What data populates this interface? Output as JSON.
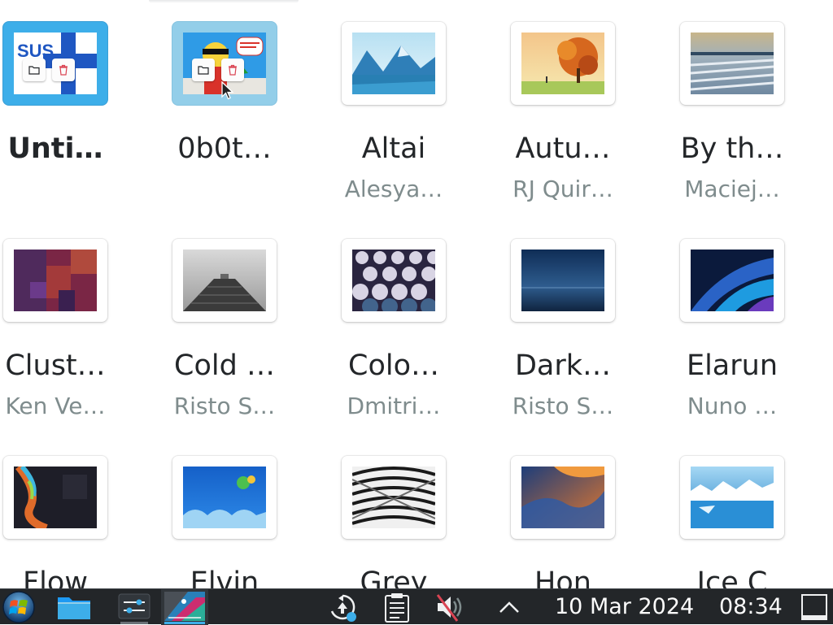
{
  "wallpapers": [
    {
      "name": "Unti…",
      "author": "",
      "state": "selected",
      "thumb": "suse-icon"
    },
    {
      "name": "0b0t…",
      "author": "",
      "state": "hovered",
      "thumb": "cartoon"
    },
    {
      "name": "Altai",
      "author": "Alesya…",
      "thumb": "altai"
    },
    {
      "name": "Autu…",
      "author": "RJ Quir…",
      "thumb": "autumn"
    },
    {
      "name": "By th…",
      "author": "Maciej…",
      "thumb": "by-the-water"
    },
    {
      "name": "Clust…",
      "author": "Ken Ve…",
      "thumb": "cluster"
    },
    {
      "name": "Cold …",
      "author": "Risto S…",
      "thumb": "cold-ripple"
    },
    {
      "name": "Colo…",
      "author": "Dmitri…",
      "thumb": "color-circles"
    },
    {
      "name": "Dark…",
      "author": "Risto S…",
      "thumb": "darkest-hour"
    },
    {
      "name": "Elarun",
      "author": "Nuno …",
      "thumb": "elarun"
    },
    {
      "name": "Flow",
      "author": "",
      "thumb": "flow"
    },
    {
      "name": "Elvin",
      "author": "",
      "thumb": "elvin"
    },
    {
      "name": "Grey",
      "author": "",
      "thumb": "grey"
    },
    {
      "name": "Hon",
      "author": "",
      "thumb": "honeywave"
    },
    {
      "name": "Ice C",
      "author": "",
      "thumb": "ice-cold"
    }
  ],
  "card_actions": {
    "open_folder_icon": "folder-icon",
    "remove_icon": "trash-icon"
  },
  "taskbar": {
    "launcher_icon": "start-orb-icon",
    "tasks": [
      {
        "name": "file-manager",
        "icon": "folder-icon",
        "state": "normal"
      },
      {
        "name": "system-settings",
        "icon": "settings-sliders-icon",
        "state": "open"
      },
      {
        "name": "discover",
        "icon": "app-icon",
        "state": "active"
      }
    ],
    "tray": [
      {
        "name": "updates",
        "icon": "update-icon"
      },
      {
        "name": "clipboard",
        "icon": "clipboard-icon"
      },
      {
        "name": "volume",
        "icon": "volume-muted-icon"
      },
      {
        "name": "expand",
        "icon": "chevron-up-icon"
      }
    ],
    "clock": {
      "date": "10 Mar 2024",
      "time": "08:34"
    },
    "show_desktop_icon": "show-desktop-icon"
  },
  "colors": {
    "accent": "#3daee9",
    "taskbar_bg": "#232629",
    "text": "#232629",
    "subtext": "#7f8c8d"
  }
}
